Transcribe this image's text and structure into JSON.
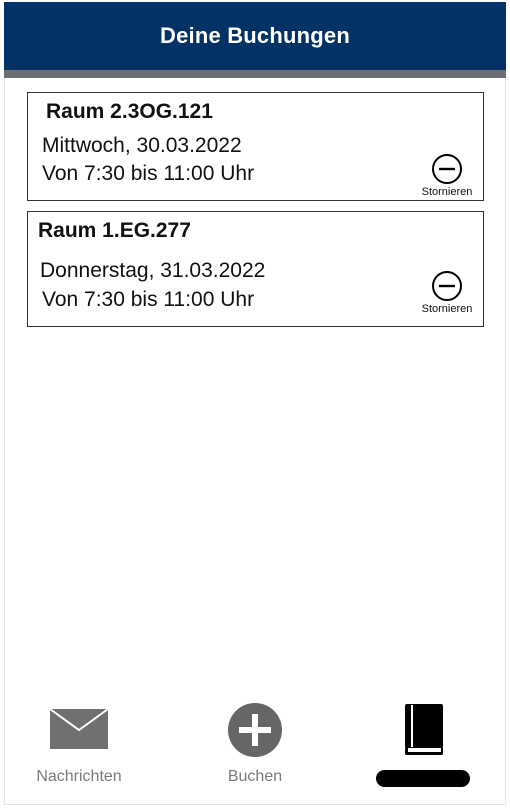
{
  "header": {
    "title": "Deine Buchungen"
  },
  "bookings": [
    {
      "room": "Raum 2.3OG.121",
      "date": "Mittwoch, 30.03.2022",
      "time": "Von 7:30 bis 11:00 Uhr",
      "cancel_label": "Stornieren"
    },
    {
      "room": "Raum 1.EG.277",
      "date": "Donnerstag, 31.03.2022",
      "time": "Von 7:30 bis 11:00 Uhr",
      "cancel_label": "Stornieren"
    }
  ],
  "nav": [
    {
      "label": "Nachrichten",
      "icon": "envelope-icon"
    },
    {
      "label": "Buchen",
      "icon": "plus-circle-icon"
    },
    {
      "label": "",
      "icon": "book-icon",
      "active": true
    }
  ],
  "colors": {
    "header_bg": "#033366",
    "header_stripe": "#6b6e75",
    "nav_icon_gray": "#707070",
    "active": "#000000"
  }
}
